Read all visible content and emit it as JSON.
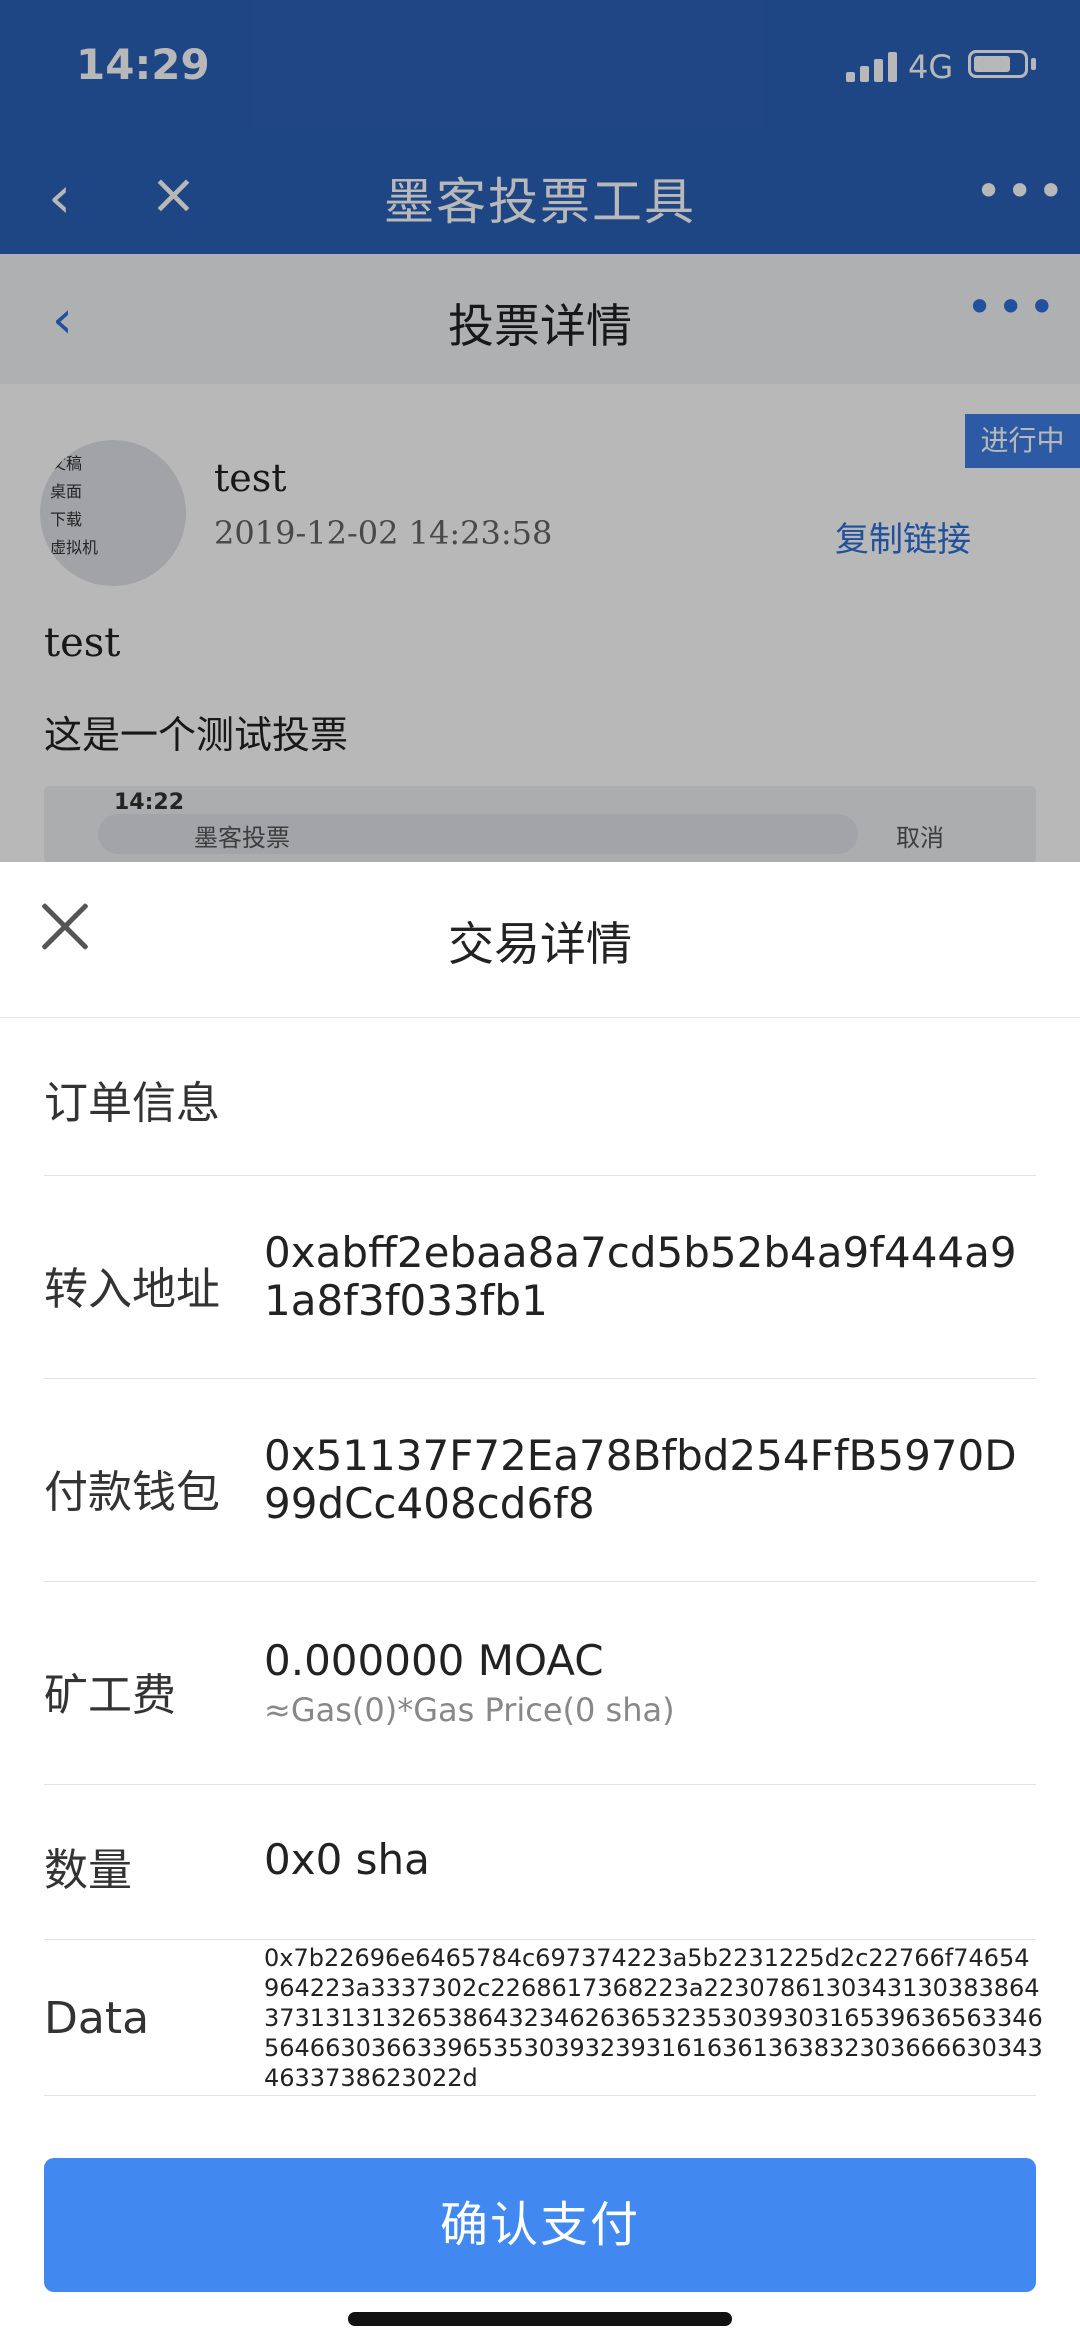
{
  "status_bar": {
    "time": "14:29",
    "network": "4G"
  },
  "nav": {
    "title": "墨客投票工具",
    "back_glyph": "‹",
    "close_glyph": "×",
    "more_glyph": "•••"
  },
  "subnav": {
    "title": "投票详情",
    "back_glyph": "‹",
    "more_glyph": "•••"
  },
  "post": {
    "status_tag": "进行中",
    "author": "test",
    "time": "2019-12-02 14:23:58",
    "copy_link": "复制链接",
    "title": "test",
    "description": "这是一个测试投票",
    "avatar_lines": [
      "文稿",
      "桌面",
      "下载",
      "虚拟机"
    ],
    "preview": {
      "time": "14:22",
      "search_text": "墨客投票",
      "cancel": "取消"
    }
  },
  "sheet": {
    "title": "交易详情",
    "order_info_label": "订单信息",
    "to_address": {
      "label": "转入地址",
      "value": "0xabff2ebaa8a7cd5b52b4a9f444a91a8f3f033fb1"
    },
    "from_wallet": {
      "label": "付款钱包",
      "value": "0x51137F72Ea78Bfbd254FfB5970D99dCc408cd6f8"
    },
    "fee": {
      "label": "矿工费",
      "value": "0.000000 MOAC",
      "detail": "≈Gas(0)*Gas Price(0 sha)"
    },
    "amount": {
      "label": "数量",
      "value": "0x0 sha"
    },
    "data": {
      "label": "Data",
      "value": "0x7b22696e6465784c697374223a5b2231225d2c22766f74654964223a3337302c2268617368223a22307861303431303838643731313132653864323462636532353039303165396365633465646630366339653530393239316163613638323036666303434633738623022d"
    },
    "confirm_button": "确认支付"
  },
  "colors": {
    "header_blue": "#2c61b8",
    "link_blue": "#2f6fd9",
    "button_blue": "#4189f1"
  },
  "icons": [
    "back-icon",
    "close-icon",
    "more-icon",
    "signal-icon",
    "battery-icon"
  ]
}
